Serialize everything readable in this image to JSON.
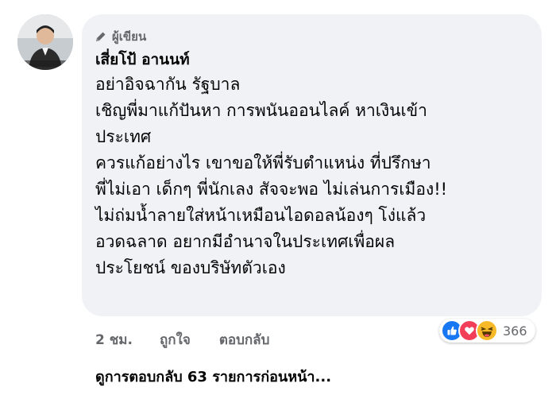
{
  "comment": {
    "role_label": "ผู้เขียน",
    "role_icon": "pen-icon",
    "author_name": "เสี่ยโป้ อานนท์",
    "body_lines": [
      "อย่าอิจฉากัน รัฐบาล",
      "เชิญพี่มาแก้ปันหา การพนันออนไลค์ หาเงินเข้า",
      "ประเทศ",
      "ควรแก้อย่างไร เขาขอให้พี่รับตำแหน่ง ที่ปรึกษา",
      "พี่ไม่เอา เด็กๆ พี่นักเลง สัจจะพอ ไม่เล่นการเมือง!!",
      "ไม่ถ่มน้ำลายใส่หน้าเหมือนไอดอลน้องๆ โง่แล้ว",
      "อวดฉลาด อยากมีอำนาจในประเทศเพื่อผล",
      "ประโยชน์ ของบริษัทตัวเอง"
    ]
  },
  "actions": {
    "time": "2 ชม.",
    "like_label": "ถูกใจ",
    "reply_label": "ตอบกลับ"
  },
  "reactions": {
    "icons": [
      "like-icon",
      "love-icon",
      "haha-icon"
    ],
    "count": "366",
    "colors": {
      "like": "#1877f2",
      "love": "#f33e58",
      "haha": "#f7b928"
    }
  },
  "view_more_replies": "ดูการตอบกลับ 63 รายการก่อนหน้า..."
}
